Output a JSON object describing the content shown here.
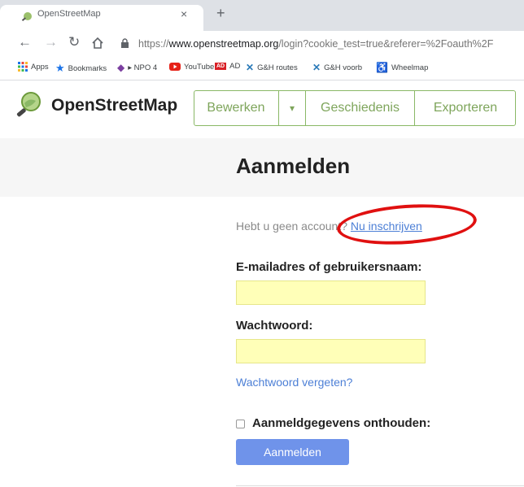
{
  "browser": {
    "tab_title": "OpenStreetMap",
    "tab_close": "×",
    "new_tab": "+",
    "url_prefix": "https://",
    "url_domain": "www.openstreetmap.org",
    "url_path": "/login?cookie_test=true&referer=%2Foauth%2F",
    "bookmarks": [
      {
        "label": "Apps",
        "icon": "apps-grid-icon",
        "color": "#1a73e8"
      },
      {
        "label": "Bookmarks",
        "icon": "star-icon",
        "color": "#1a73e8"
      },
      {
        "label": "▸ NPO 4",
        "icon": "npo-icon",
        "color": "#7b3fa0"
      },
      {
        "label": "YouTube",
        "icon": "youtube-icon",
        "color": "#e62117"
      },
      {
        "label": "AD",
        "icon": "ad-icon",
        "color": "#d81f26"
      },
      {
        "label": "G&H routes",
        "icon": "gh-icon",
        "color": "#2a7ab8"
      },
      {
        "label": "G&H voorb",
        "icon": "gh-icon",
        "color": "#2a7ab8"
      },
      {
        "label": "Wheelmap",
        "icon": "wheelmap-icon",
        "color": "#6aa84f"
      }
    ]
  },
  "header": {
    "site_name": "OpenStreetMap",
    "tabs": {
      "edit": "Bewerken",
      "edit_dropdown": "▾",
      "history": "Geschiedenis",
      "export": "Exporteren"
    }
  },
  "login": {
    "heading": "Aanmelden",
    "no_account_text": "Hebt u geen account? ",
    "signup_link": "Nu inschrijven",
    "email_label": "E-mailadres of gebruikersnaam:",
    "email_value": "",
    "password_label": "Wachtwoord:",
    "password_value": "",
    "forgot_link": "Wachtwoord vergeten?",
    "remember_label": "Aanmeldgegevens onthouden:",
    "submit_label": "Aanmelden"
  },
  "colors": {
    "accent_green": "#7ea55b",
    "link_blue": "#4c7fd6",
    "button_blue": "#6f93ea",
    "field_yellow": "#ffffb8",
    "annotation_red": "#e01010"
  }
}
